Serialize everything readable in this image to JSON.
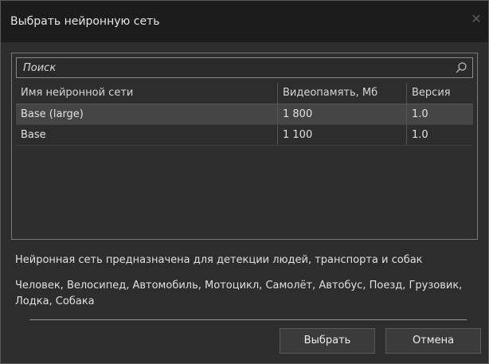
{
  "dialog": {
    "title": "Выбрать нейронную сеть",
    "close_label": "✕"
  },
  "search": {
    "placeholder": "Поиск",
    "value": ""
  },
  "table": {
    "headers": [
      "Имя нейронной сети",
      "Видеопамять, Мб",
      "Версия"
    ],
    "rows": [
      {
        "name": "Base (large)",
        "vram": "1 800",
        "version": "1.0",
        "selected": true
      },
      {
        "name": "Base",
        "vram": "1 100",
        "version": "1.0",
        "selected": false
      }
    ]
  },
  "description": "Нейронная сеть предназначена для детекции людей, транспорта и собак",
  "classes": "Человек, Велосипед, Автомобиль, Мотоцикл, Самолёт, Автобус, Поезд, Грузовик, Лодка, Собака",
  "buttons": {
    "select_label": "Выбрать",
    "cancel_label": "Отмена"
  },
  "icons": {
    "search": "search-icon",
    "close": "close-icon"
  },
  "colors": {
    "titlebar": "#1c1c1c",
    "background": "#2d2d2d",
    "selected_row": "#454545"
  }
}
